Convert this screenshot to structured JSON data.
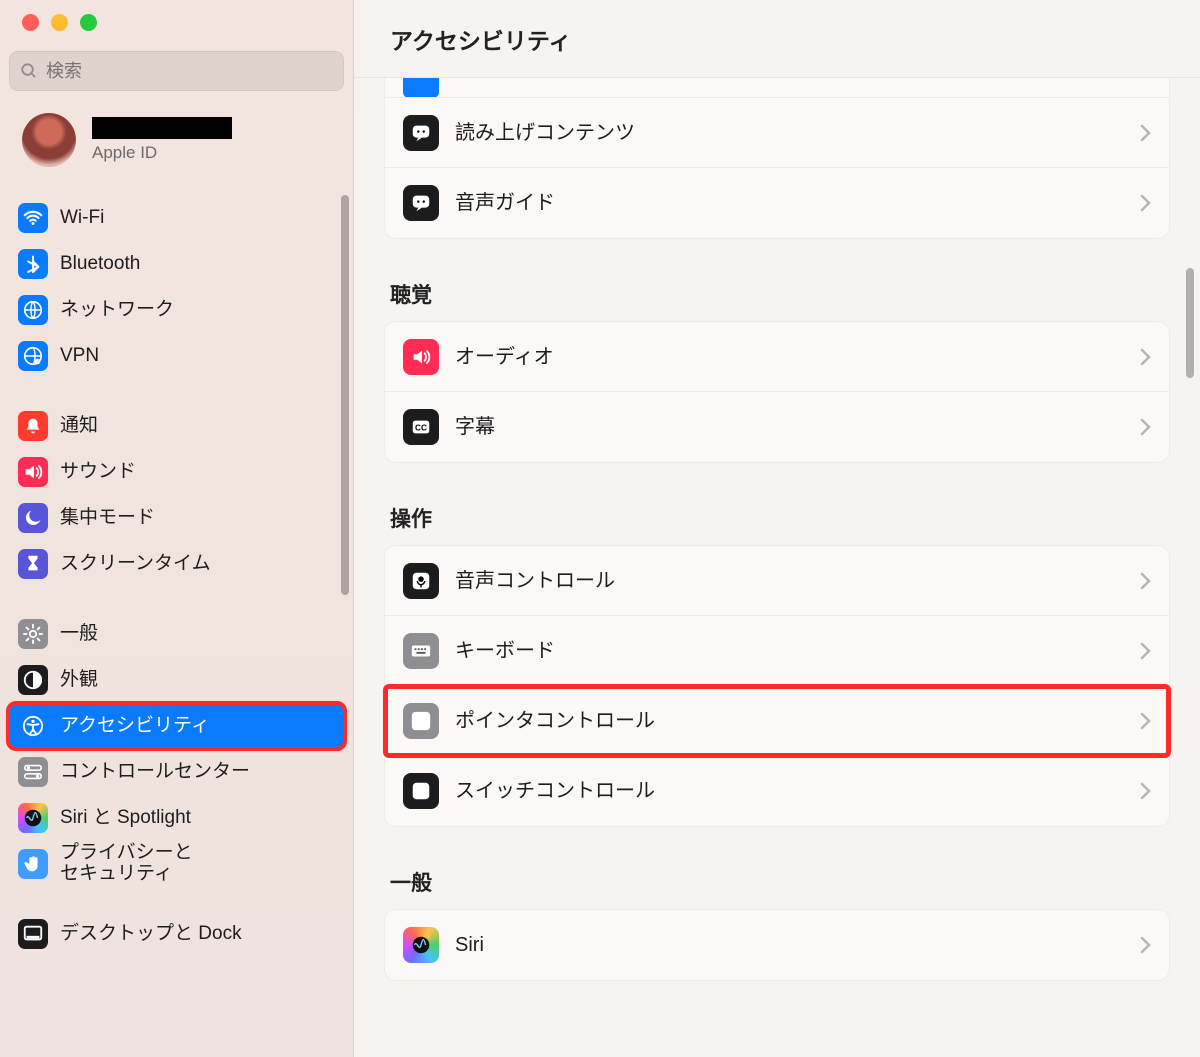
{
  "search": {
    "placeholder": "検索"
  },
  "account": {
    "sub": "Apple ID"
  },
  "sidebar": [
    {
      "id": "wifi",
      "label": "Wi-Fi",
      "color": "b-blue"
    },
    {
      "id": "bluetooth",
      "label": "Bluetooth",
      "color": "b-blue"
    },
    {
      "id": "network",
      "label": "ネットワーク",
      "color": "b-blue"
    },
    {
      "id": "vpn",
      "label": "VPN",
      "color": "b-blue"
    },
    {
      "gap": true
    },
    {
      "id": "notifications",
      "label": "通知",
      "color": "b-red"
    },
    {
      "id": "sound",
      "label": "サウンド",
      "color": "b-pink"
    },
    {
      "id": "focus",
      "label": "集中モード",
      "color": "b-purple"
    },
    {
      "id": "screentime",
      "label": "スクリーンタイム",
      "color": "b-purple"
    },
    {
      "gap": true
    },
    {
      "id": "general",
      "label": "一般",
      "color": "b-gray"
    },
    {
      "id": "appearance",
      "label": "外観",
      "color": "b-black"
    },
    {
      "id": "accessibility",
      "label": "アクセシビリティ",
      "color": "b-blue",
      "selected": true,
      "highlight": true
    },
    {
      "id": "controlcenter",
      "label": "コントロールセンター",
      "color": "b-gray"
    },
    {
      "id": "siri",
      "label": "Siri と Spotlight",
      "color": "b-grad"
    },
    {
      "id": "privacy",
      "label": "プライバシーと\nセキュリティ",
      "color": "b-lblue"
    },
    {
      "gap": true
    },
    {
      "id": "desktop",
      "label": "デスクトップと Dock",
      "color": "b-black"
    }
  ],
  "main": {
    "title": "アクセシビリティ",
    "sections": [
      {
        "title": null,
        "rows": [
          {
            "id": "spoken",
            "label": "読み上げコンテンツ",
            "color": "b-black"
          },
          {
            "id": "descriptions",
            "label": "音声ガイド",
            "color": "b-black"
          }
        ],
        "topCut": true
      },
      {
        "title": "聴覚",
        "rows": [
          {
            "id": "audio",
            "label": "オーディオ",
            "color": "b-pink"
          },
          {
            "id": "captions",
            "label": "字幕",
            "color": "b-black"
          }
        ]
      },
      {
        "title": "操作",
        "rows": [
          {
            "id": "voicecontrol",
            "label": "音声コントロール",
            "color": "b-black"
          },
          {
            "id": "keyboard",
            "label": "キーボード",
            "color": "b-gray"
          },
          {
            "id": "pointer",
            "label": "ポインタコントロール",
            "color": "b-gray",
            "highlight": true
          },
          {
            "id": "switch",
            "label": "スイッチコントロール",
            "color": "b-black"
          }
        ]
      },
      {
        "title": "一般",
        "rows": [
          {
            "id": "siri2",
            "label": "Siri",
            "color": "b-grad"
          }
        ]
      }
    ]
  },
  "icons": {
    "wifi": "wifi",
    "bluetooth": "bt",
    "network": "globe",
    "vpn": "globe-key",
    "notifications": "bell",
    "sound": "speaker",
    "focus": "moon",
    "screentime": "hourglass",
    "general": "gear",
    "appearance": "contrast",
    "accessibility": "access",
    "controlcenter": "switches",
    "siri": "siri",
    "privacy": "hand",
    "desktop": "dock",
    "spoken": "bubble",
    "descriptions": "bubble",
    "audio": "speaker",
    "captions": "cc",
    "voicecontrol": "mic",
    "keyboard": "kbd",
    "pointer": "cursor",
    "switch": "grid",
    "siri2": "siri"
  }
}
